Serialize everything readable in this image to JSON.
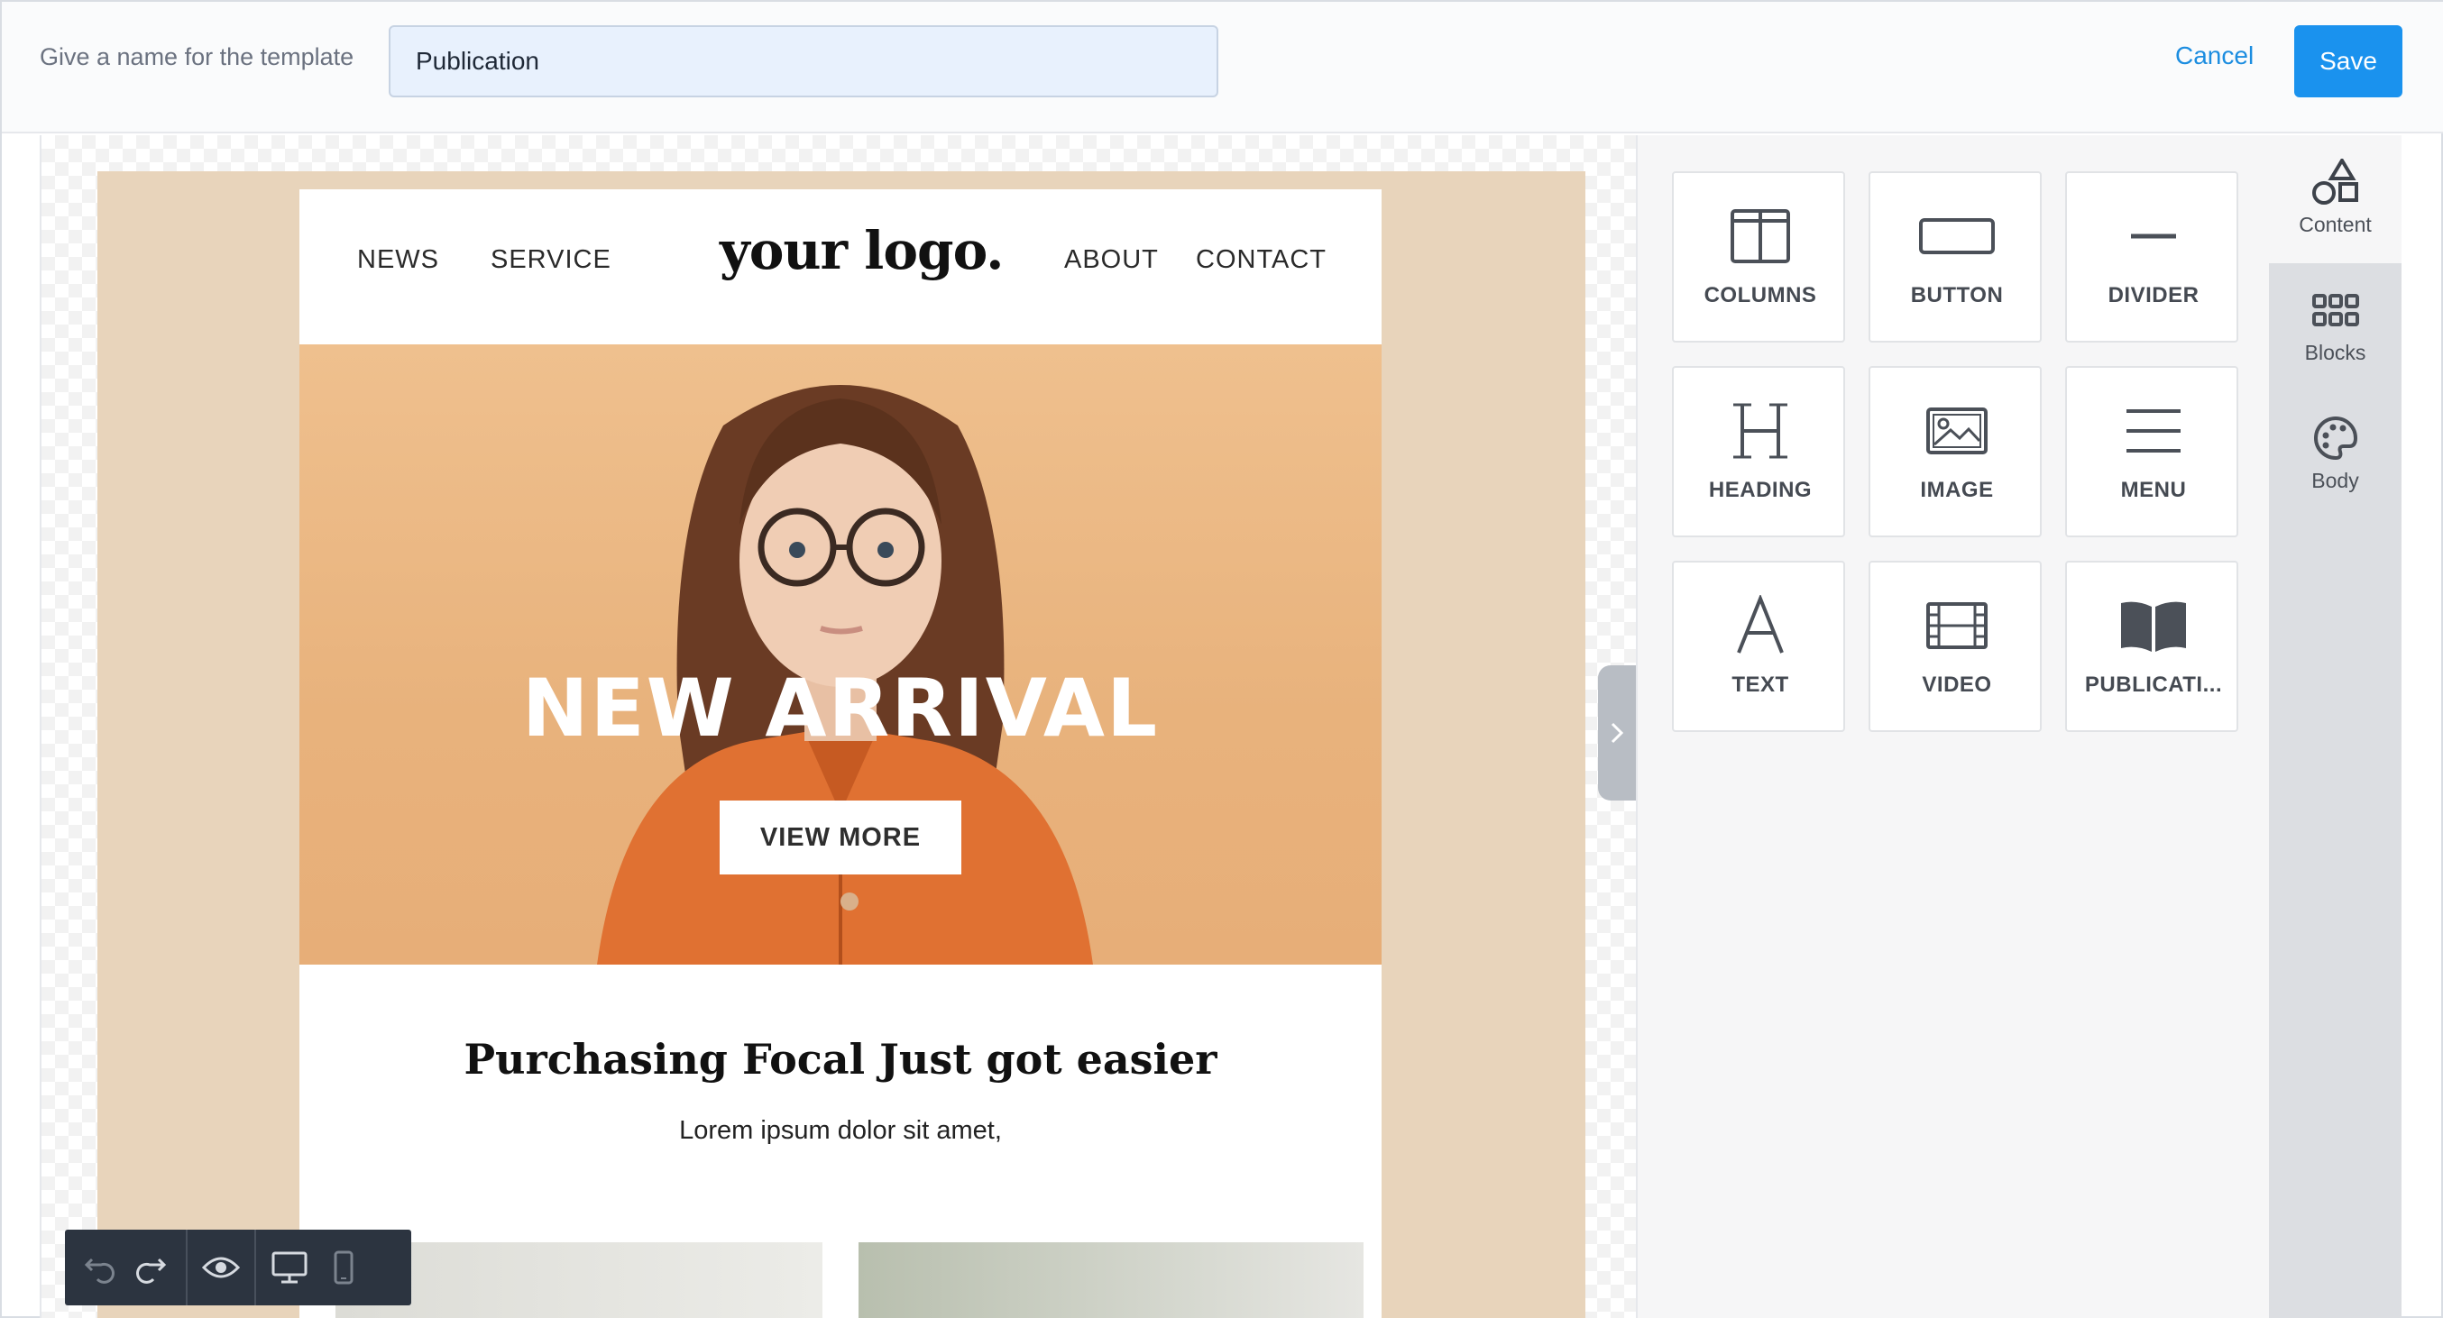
{
  "header": {
    "template_label": "Give a name for the template",
    "template_name": "Publication",
    "cancel_label": "Cancel",
    "save_label": "Save"
  },
  "email": {
    "nav_left": [
      "NEWS",
      "SERVICE"
    ],
    "logo": "your logo.",
    "nav_right": [
      "ABOUT",
      "CONTACT"
    ],
    "hero_title": "NEW ARRIVAL",
    "hero_button": "VIEW MORE",
    "headline": "Purchasing Focal Just got easier",
    "subline": "Lorem ipsum dolor sit amet,"
  },
  "canvas_tools": [
    "undo-icon",
    "redo-icon",
    "eye-icon",
    "desktop-icon",
    "mobile-icon"
  ],
  "content_tiles": [
    {
      "label": "COLUMNS",
      "icon": "columns-icon"
    },
    {
      "label": "BUTTON",
      "icon": "button-icon"
    },
    {
      "label": "DIVIDER",
      "icon": "divider-icon"
    },
    {
      "label": "HEADING",
      "icon": "heading-icon"
    },
    {
      "label": "IMAGE",
      "icon": "image-icon"
    },
    {
      "label": "MENU",
      "icon": "menu-icon"
    },
    {
      "label": "TEXT",
      "icon": "text-icon"
    },
    {
      "label": "VIDEO",
      "icon": "video-icon"
    },
    {
      "label": "PUBLICATI...",
      "icon": "book-icon"
    }
  ],
  "rail": [
    {
      "label": "Content",
      "icon": "shapes-icon",
      "active": true
    },
    {
      "label": "Blocks",
      "icon": "grid-icon",
      "active": false
    },
    {
      "label": "Body",
      "icon": "palette-icon",
      "active": false
    }
  ],
  "colors": {
    "accent": "#1a92ee",
    "email_background": "#e8d4bb",
    "hero_background": "#e8b27c"
  }
}
